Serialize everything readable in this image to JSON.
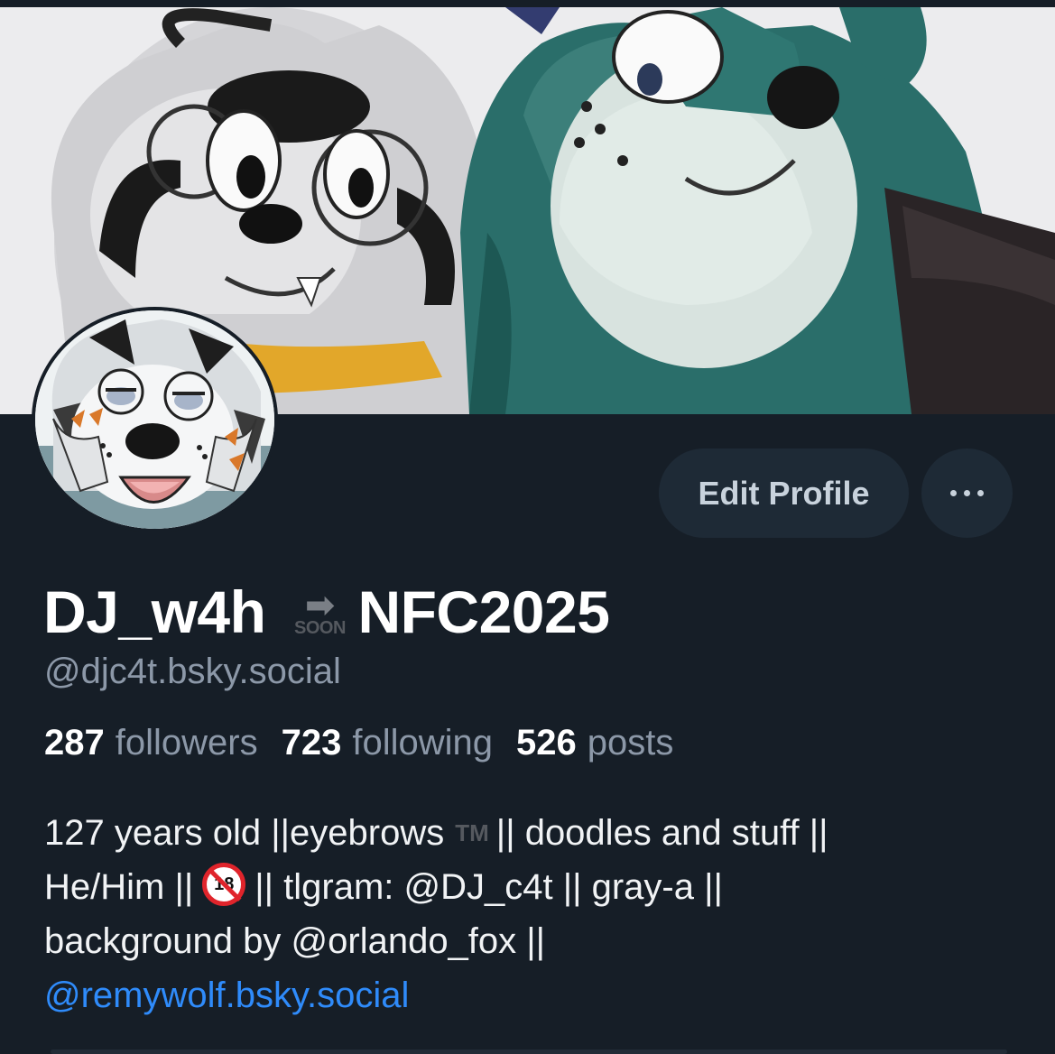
{
  "profile": {
    "display_name_part1": "DJ_w4h",
    "soon_emoji_arrow": "➡",
    "soon_emoji_text": "SOON",
    "display_name_part2": "NFC2025",
    "handle": "@djc4t.bsky.social"
  },
  "actions": {
    "edit_profile_label": "Edit Profile",
    "more_icon": "more-horizontal-icon"
  },
  "stats": {
    "followers_count": "287",
    "followers_label": "followers",
    "following_count": "723",
    "following_label": "following",
    "posts_count": "526",
    "posts_label": "posts"
  },
  "bio": {
    "line1_text": "127 years old ||eyebrows",
    "line1_tm": "TM",
    "line1_rest": "|| doodles and stuff ||",
    "line2_a": "He/Him ||",
    "line2_no18_label": "18",
    "line2_b": "|| tlgram: @DJ_c4t || gray-a ||",
    "line3": "background by @orlando_fox ||",
    "link": "@remywolf.bsky.social"
  },
  "colors": {
    "background": "#161e27",
    "button_bg": "#1e2a36",
    "muted_text": "#8c98a8",
    "link": "#2f8bfa"
  }
}
